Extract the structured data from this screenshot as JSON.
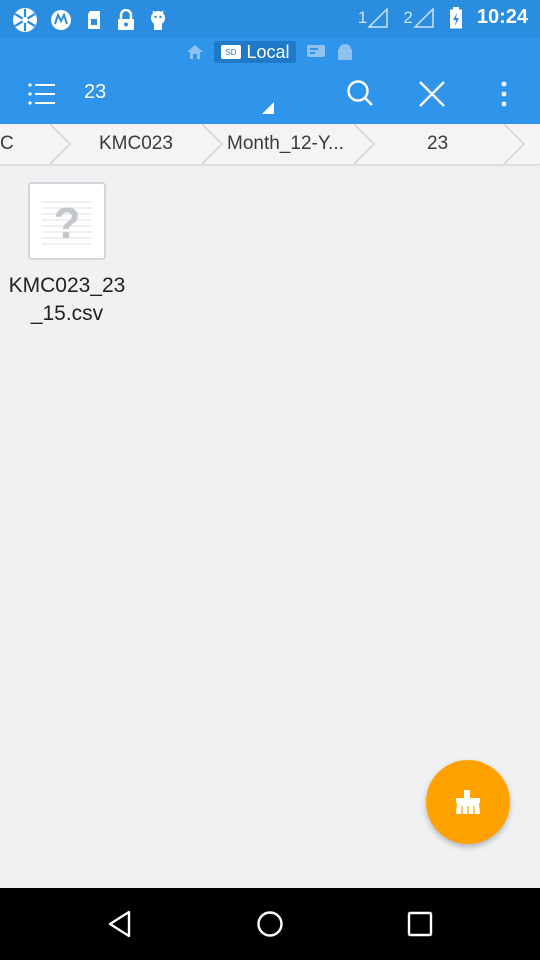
{
  "status_bar": {
    "time": "10:24",
    "sim1_label": "1",
    "sim2_label": "2",
    "icons": [
      "app-icon",
      "motorola-icon",
      "sim-icon",
      "lock-icon",
      "android-icon"
    ]
  },
  "storage": {
    "label": "Local",
    "sd_badge": "SD"
  },
  "toolbar": {
    "path_title": "23"
  },
  "breadcrumbs": [
    {
      "label": "C"
    },
    {
      "label": "KMC023"
    },
    {
      "label": "Month_12-Y..."
    },
    {
      "label": "23"
    }
  ],
  "files": [
    {
      "name": "KMC023_23_15.csv",
      "type": "unknown"
    }
  ],
  "colors": {
    "status_bar": "#2a8de0",
    "app_bar": "#2e95ea",
    "fab": "#ffa200",
    "background": "#f0f1f3"
  }
}
